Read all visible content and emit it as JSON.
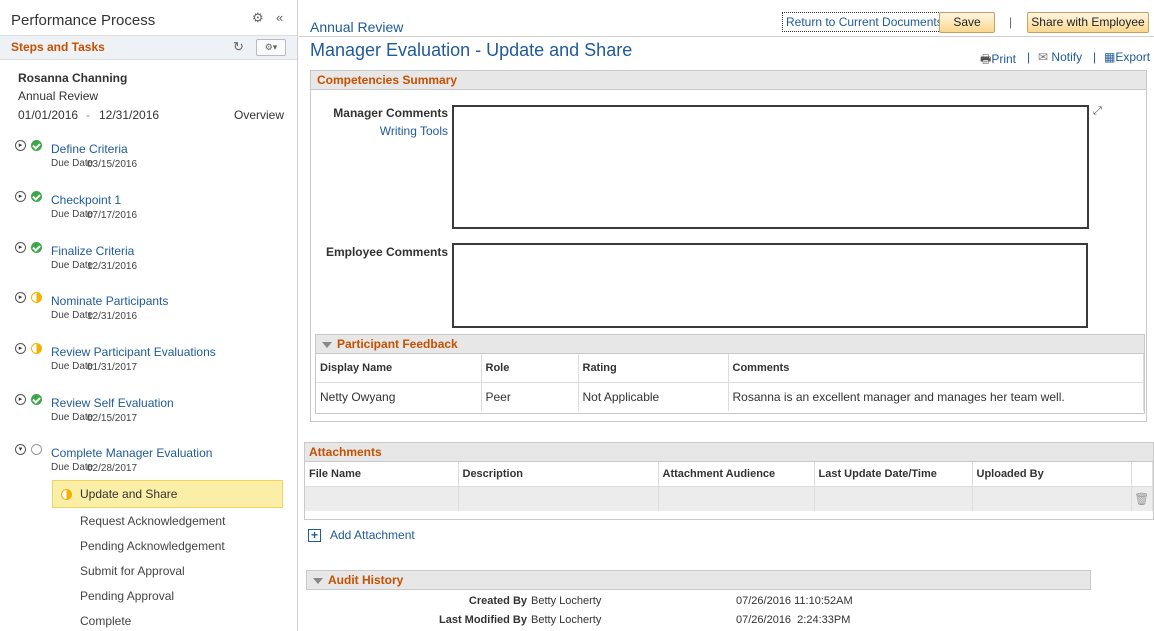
{
  "left": {
    "title": "Performance Process",
    "steps_header": "Steps and Tasks",
    "employee_name": "Rosanna Channing",
    "document_type": "Annual Review",
    "period_start": "01/01/2016",
    "period_sep": "-",
    "period_end": "12/31/2016",
    "overview_link": "Overview",
    "due_label": "Due Date",
    "tasks": [
      {
        "name": "Define Criteria",
        "due": "03/15/2016",
        "status": "complete"
      },
      {
        "name": "Checkpoint 1",
        "due": "07/17/2016",
        "status": "complete"
      },
      {
        "name": "Finalize Criteria",
        "due": "12/31/2016",
        "status": "complete"
      },
      {
        "name": "Nominate Participants",
        "due": "12/31/2016",
        "status": "in-progress"
      },
      {
        "name": "Review Participant Evaluations",
        "due": "01/31/2017",
        "status": "in-progress"
      },
      {
        "name": "Review Self Evaluation",
        "due": "02/15/2017",
        "status": "complete"
      },
      {
        "name": "Complete Manager Evaluation",
        "due": "02/28/2017",
        "status": "not-started"
      }
    ],
    "subtasks": [
      {
        "name": "Update and Share",
        "active": true
      },
      {
        "name": "Request Acknowledgement"
      },
      {
        "name": "Pending Acknowledgement"
      },
      {
        "name": "Submit for Approval"
      },
      {
        "name": "Pending Approval"
      },
      {
        "name": "Complete"
      }
    ]
  },
  "main": {
    "breadcrumb": "Annual Review",
    "page_title": "Manager Evaluation - Update and Share",
    "return_link": "Return to Current Documents",
    "save_label": "Save",
    "share_label": "Share with Employee",
    "pipe": "|",
    "print_label": "Print",
    "notify_label": "Notify",
    "export_label": "Export",
    "competencies": {
      "header": "Competencies Summary",
      "manager_comments_label": "Manager Comments",
      "writing_tools": "Writing Tools",
      "manager_comments_value": "",
      "employee_comments_label": "Employee Comments",
      "employee_comments_value": ""
    },
    "feedback": {
      "header": "Participant Feedback",
      "columns": [
        "Display Name",
        "Role",
        "Rating",
        "Comments"
      ],
      "rows": [
        [
          "Netty Owyang",
          "Peer",
          "Not Applicable",
          "Rosanna is an excellent manager and manages her team well."
        ]
      ]
    },
    "attachments": {
      "header": "Attachments",
      "columns": [
        "File Name",
        "Description",
        "Attachment Audience",
        "Last Update Date/Time",
        "Uploaded By"
      ],
      "add_label": "Add Attachment"
    },
    "audit": {
      "header": "Audit History",
      "created_label": "Created By",
      "created_by": "Betty Locherty",
      "created_at": "07/26/2016 11:10:52AM",
      "modified_label": "Last Modified By",
      "modified_by": "Betty Locherty",
      "modified_at": "07/26/2016  2:24:33PM"
    }
  },
  "colors": {
    "accent": "#1f5a9a",
    "section_header": "#c65100",
    "complete": "#3ea64b",
    "in_progress": "#f2b200"
  }
}
